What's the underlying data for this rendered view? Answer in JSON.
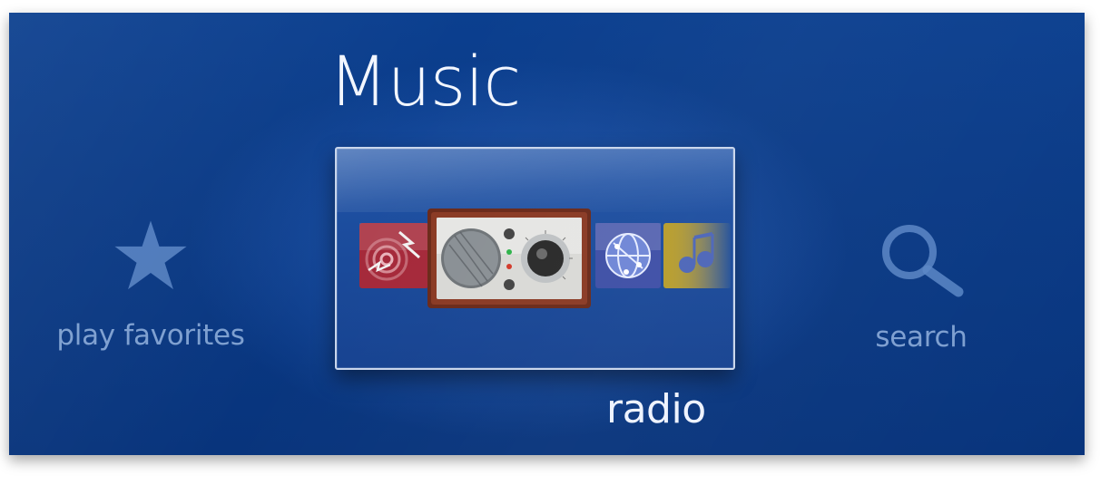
{
  "page": {
    "title": "Music"
  },
  "menu": {
    "left": {
      "label": "play favorites",
      "icon": "star-icon"
    },
    "center": {
      "label": "radio",
      "icon": "radio-icon"
    },
    "right": {
      "label": "search",
      "icon": "magnifier-icon"
    }
  },
  "strip_icons": [
    "radio-waves-icon",
    "radio-icon",
    "internet-globe-icon",
    "music-notes-icon"
  ],
  "colors": {
    "background": "#0a3a86",
    "title_text": "#f2f6ff",
    "inactive_text": "#7d9fd0",
    "tile_border": "#c9d6ec"
  }
}
